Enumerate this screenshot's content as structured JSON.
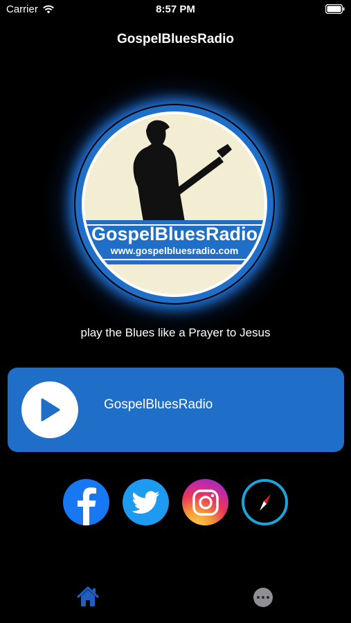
{
  "status_bar": {
    "carrier": "Carrier",
    "time": "8:57 PM"
  },
  "nav": {
    "title": "GospelBluesRadio"
  },
  "logo": {
    "brand": "GospelBluesRadio",
    "url": "www.gospelbluesradio.com"
  },
  "tagline": "play the Blues like  a Prayer to Jesus",
  "player": {
    "station_name": "GospelBluesRadio",
    "state": "stopped"
  },
  "social": [
    {
      "name": "facebook",
      "icon": "facebook-icon"
    },
    {
      "name": "twitter",
      "icon": "twitter-icon"
    },
    {
      "name": "instagram",
      "icon": "instagram-icon"
    },
    {
      "name": "safari",
      "icon": "compass-icon"
    }
  ],
  "tab_bar": [
    {
      "name": "home",
      "icon": "home-icon",
      "active": true
    },
    {
      "name": "more",
      "icon": "more-icon",
      "active": false
    }
  ],
  "colors": {
    "accent": "#1f6ec7",
    "background": "#000000",
    "active_tab": "#1e5fc4"
  }
}
